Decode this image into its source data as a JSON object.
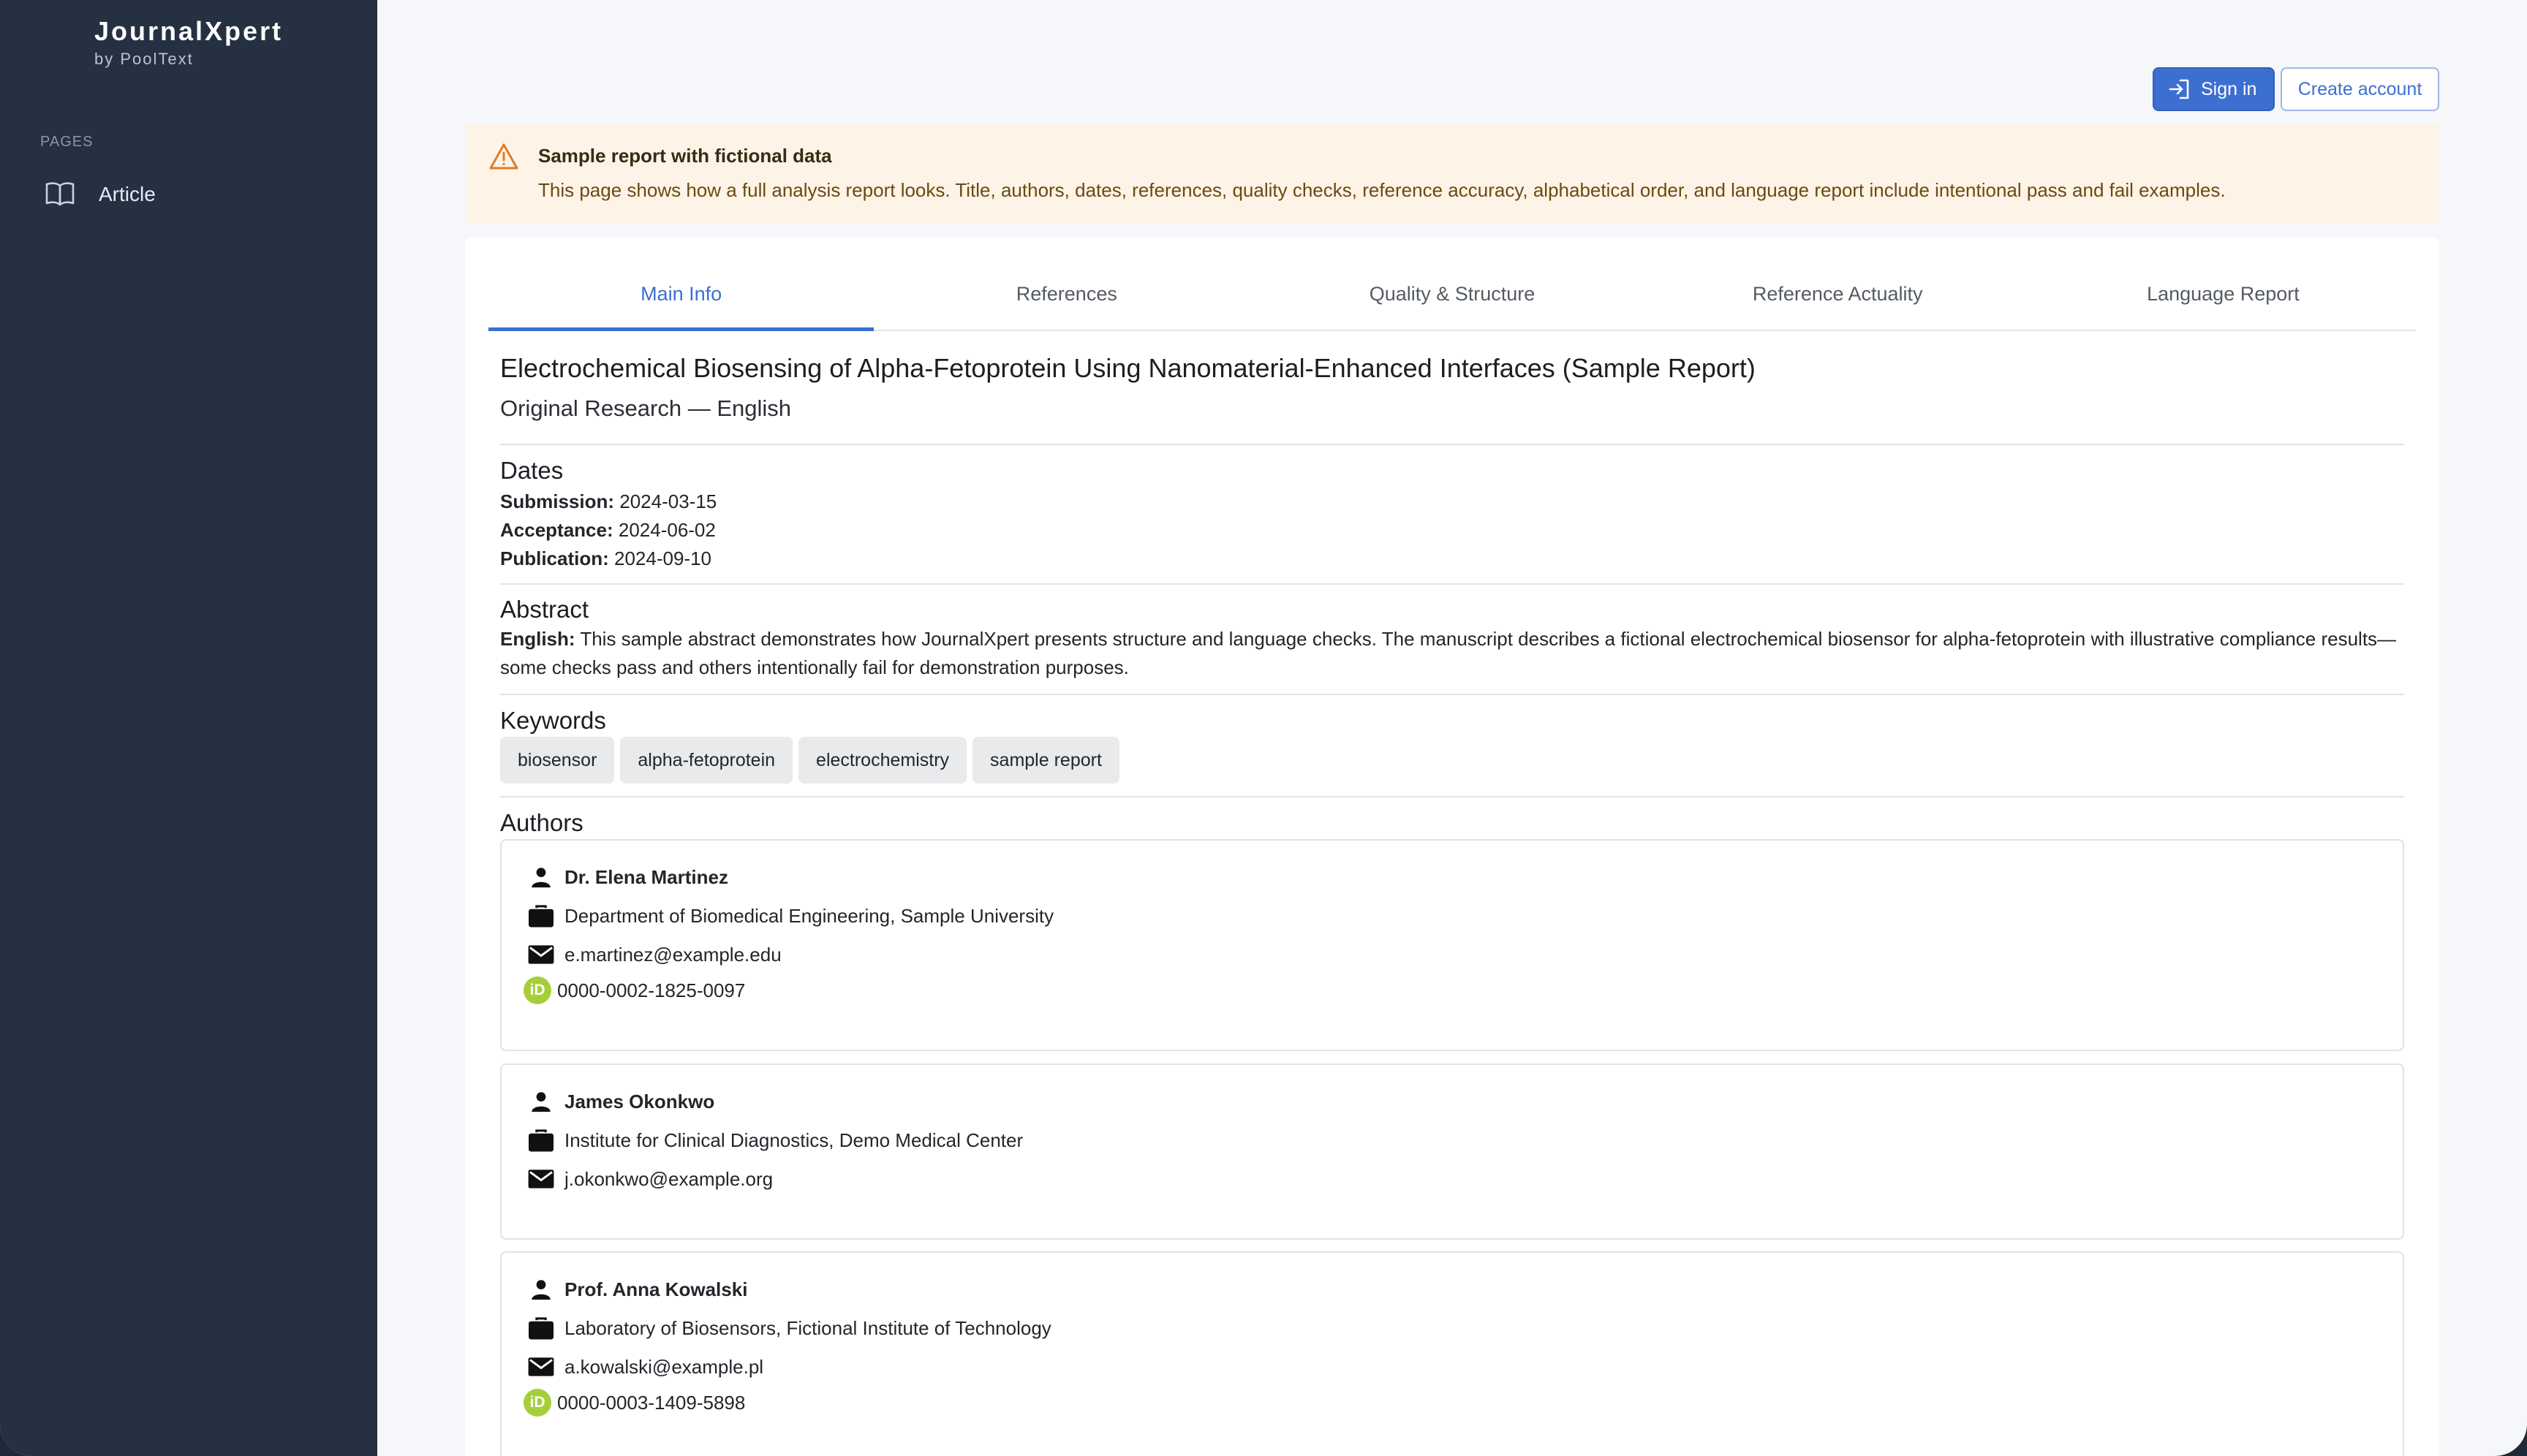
{
  "sidebar": {
    "brand_title": "JournalXpert",
    "brand_sub": "by PoolText",
    "pages_label": "PAGES",
    "items": [
      {
        "label": "Article",
        "icon": "book-open-icon"
      }
    ]
  },
  "header": {
    "signin_label": "Sign in",
    "create_label": "Create account"
  },
  "banner": {
    "title": "Sample report with fictional data",
    "text": "This page shows how a full analysis report looks. Title, authors, dates, references, quality checks, reference accuracy, alphabetical order, and language report include intentional pass and fail examples."
  },
  "tabs": [
    {
      "label": "Main Info",
      "active": true
    },
    {
      "label": "References",
      "active": false
    },
    {
      "label": "Quality & Structure",
      "active": false
    },
    {
      "label": "Reference Actuality",
      "active": false
    },
    {
      "label": "Language Report",
      "active": false
    }
  ],
  "article": {
    "title": "Electrochemical Biosensing of Alpha-Fetoprotein Using Nanomaterial-Enhanced Interfaces (Sample Report)",
    "subtitle": "Original Research — English",
    "dates_heading": "Dates",
    "submission_label": "Submission:",
    "submission_value": "2024-03-15",
    "acceptance_label": "Acceptance:",
    "acceptance_value": "2024-06-02",
    "publication_label": "Publication:",
    "publication_value": "2024-09-10",
    "abstract_heading": "Abstract",
    "abstract_lang": "English:",
    "abstract_text": "This sample abstract demonstrates how JournalXpert presents structure and language checks. The manuscript describes a fictional electrochemical biosensor for alpha-fetoprotein with illustrative compliance results—some checks pass and others intentionally fail for demonstration purposes.",
    "keywords_heading": "Keywords",
    "keywords": [
      "biosensor",
      "alpha-fetoprotein",
      "electrochemistry",
      "sample report"
    ],
    "authors_heading": "Authors",
    "authors": [
      {
        "name": "Dr. Elena Martinez",
        "affiliation": "Department of Biomedical Engineering, Sample University",
        "email": "e.martinez@example.edu",
        "orcid": "0000-0002-1825-0097"
      },
      {
        "name": "James Okonkwo",
        "affiliation": "Institute for Clinical Diagnostics, Demo Medical Center",
        "email": "j.okonkwo@example.org"
      },
      {
        "name": "Prof. Anna Kowalski",
        "affiliation": "Laboratory of Biosensors, Fictional Institute of Technology",
        "email": "a.kowalski@example.pl",
        "orcid": "0000-0003-1409-5898"
      }
    ]
  },
  "colors": {
    "accent": "#3d6fd1",
    "sidebar": "#253142",
    "warning_bg": "#fdf3e6",
    "warning_icon": "#e07b2a",
    "orcid": "#a6ce39"
  }
}
